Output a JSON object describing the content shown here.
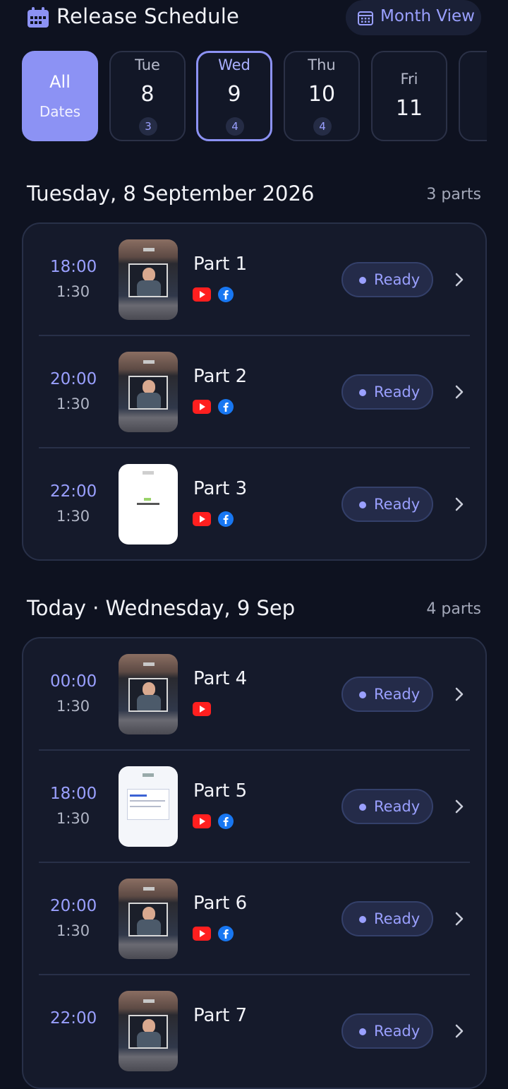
{
  "header": {
    "title": "Release Schedule",
    "month_view_label": "Month View",
    "accent": "#8c92f4"
  },
  "dates": {
    "all": {
      "line1": "All",
      "line2": "Dates",
      "selected": false
    },
    "days": [
      {
        "weekday": "Tue",
        "day": "8",
        "count": "3",
        "selected": false
      },
      {
        "weekday": "Wed",
        "day": "9",
        "count": "4",
        "selected": true
      },
      {
        "weekday": "Thu",
        "day": "10",
        "count": "4",
        "selected": false
      },
      {
        "weekday": "Fri",
        "day": "11",
        "count": "",
        "selected": false
      }
    ]
  },
  "sections": [
    {
      "title": "Tuesday, 8 September 2026",
      "count": "3 parts",
      "items": [
        {
          "time": "18:00",
          "duration": "1:30",
          "name": "Part 1",
          "thumb": "dark",
          "platforms": [
            "youtube",
            "facebook"
          ],
          "status": "Ready"
        },
        {
          "time": "20:00",
          "duration": "1:30",
          "name": "Part 2",
          "thumb": "dark",
          "platforms": [
            "youtube",
            "facebook"
          ],
          "status": "Ready"
        },
        {
          "time": "22:00",
          "duration": "1:30",
          "name": "Part 3",
          "thumb": "white",
          "platforms": [
            "youtube",
            "facebook"
          ],
          "status": "Ready"
        }
      ]
    },
    {
      "title": "Today · Wednesday, 9 Sep",
      "count": "4 parts",
      "items": [
        {
          "time": "00:00",
          "duration": "1:30",
          "name": "Part 4",
          "thumb": "dark",
          "platforms": [
            "youtube"
          ],
          "status": "Ready"
        },
        {
          "time": "18:00",
          "duration": "1:30",
          "name": "Part 5",
          "thumb": "doc",
          "platforms": [
            "youtube",
            "facebook"
          ],
          "status": "Ready"
        },
        {
          "time": "20:00",
          "duration": "1:30",
          "name": "Part 6",
          "thumb": "dark",
          "platforms": [
            "youtube",
            "facebook"
          ],
          "status": "Ready"
        },
        {
          "time": "22:00",
          "duration": "",
          "name": "Part 7",
          "thumb": "dark",
          "platforms": [],
          "status": "Ready"
        }
      ]
    }
  ]
}
